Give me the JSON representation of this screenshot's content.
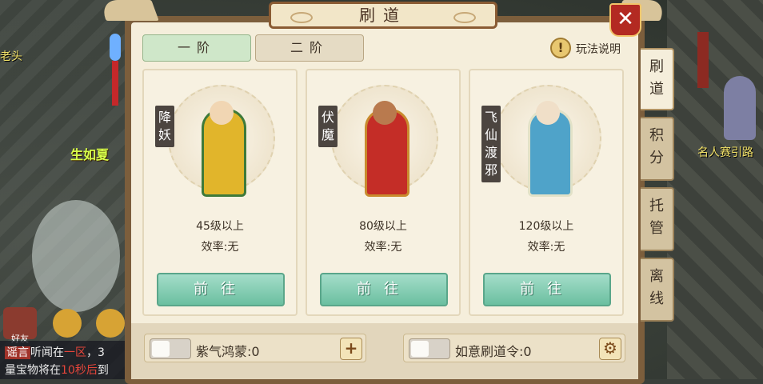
{
  "background": {
    "npc_left_name": "老头",
    "npc_right_name": "名人赛引路",
    "green_text": "生如夏"
  },
  "chat": {
    "tag": "谣言",
    "line1_a": "听闻在",
    "line1_highlight": "一区",
    "line1_b": "，3",
    "line2_a": "量宝物将在",
    "line2_highlight": "10秒后",
    "line2_b": "到"
  },
  "bottom_left": {
    "friend_label": "好友"
  },
  "panel": {
    "title": "刷道",
    "close_label": "✕"
  },
  "stage_tabs": [
    {
      "label": "一阶",
      "active": true
    },
    {
      "label": "二阶",
      "active": false
    }
  ],
  "help": {
    "icon": "!",
    "label": "玩法说明"
  },
  "cards": [
    {
      "name": "降妖",
      "level": "45级以上",
      "efficiency": "效率:无",
      "button": "前往",
      "robe_color": "#e1b52b",
      "trim_color": "#3e7a3a"
    },
    {
      "name": "伏魔",
      "level": "80级以上",
      "efficiency": "效率:无",
      "button": "前往",
      "robe_color": "#c42d27",
      "trim_color": "#c98b2e"
    },
    {
      "name": "飞仙渡邪",
      "level": "120级以上",
      "efficiency": "效率:无",
      "button": "前往",
      "robe_color": "#4fa3c9",
      "trim_color": "#e2e2c8"
    }
  ],
  "side_tabs": [
    {
      "label": "刷道",
      "active": true
    },
    {
      "label": "积分",
      "active": false
    },
    {
      "label": "托管",
      "active": false
    },
    {
      "label": "离线",
      "active": false
    }
  ],
  "toggles": [
    {
      "label": "紫气鸿蒙:0",
      "button_icon": "plus-icon",
      "button_glyph": "+"
    },
    {
      "label": "如意刷道令:0",
      "button_icon": "gear-icon",
      "button_glyph": "⚙"
    }
  ]
}
